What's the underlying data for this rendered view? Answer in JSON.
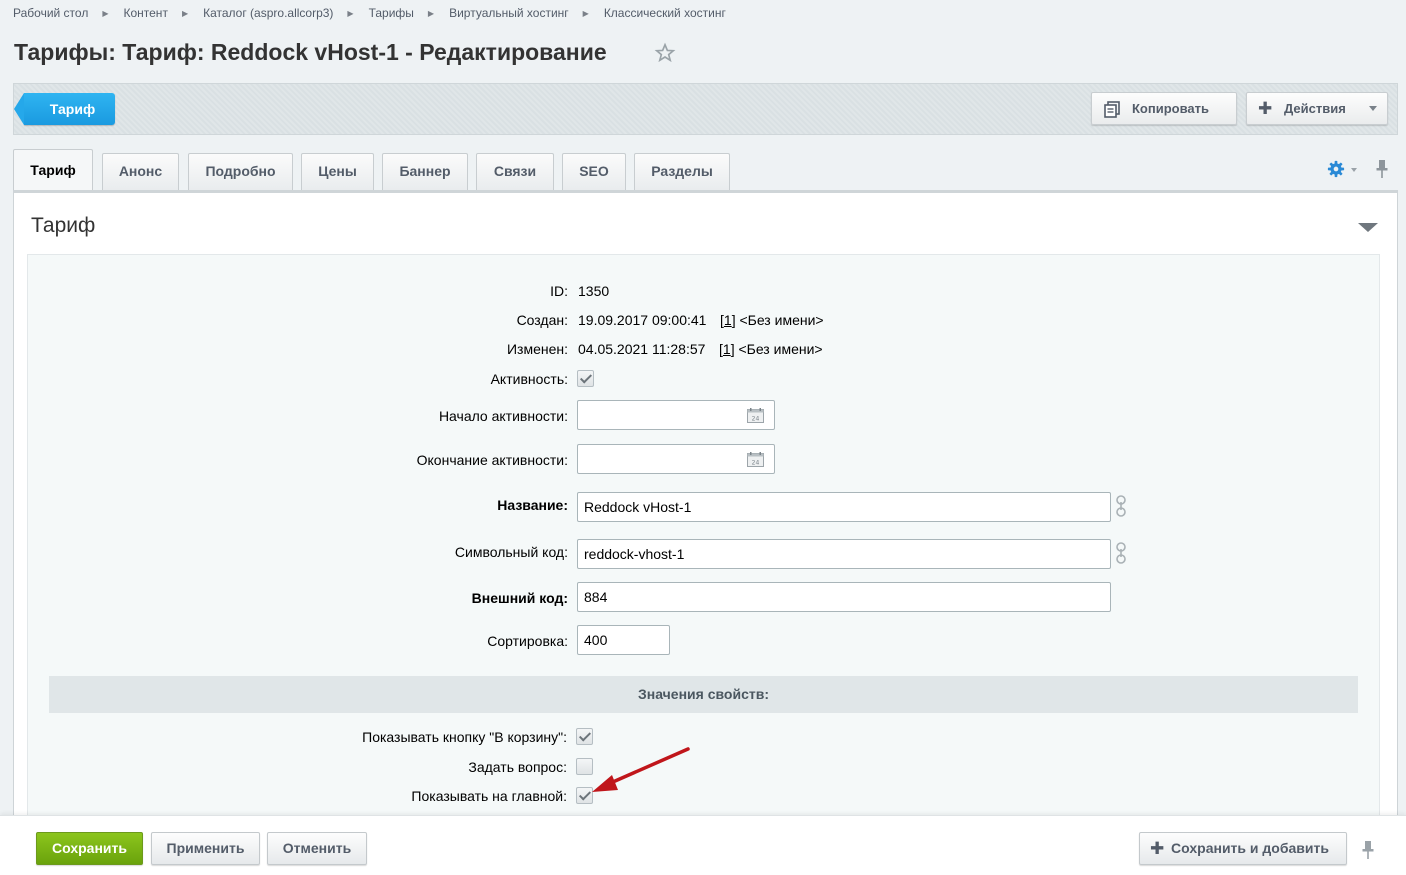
{
  "breadcrumb": [
    "Рабочий стол",
    "Контент",
    "Каталог (aspro.allcorp3)",
    "Тарифы",
    "Виртуальный хостинг",
    "Классический хостинг"
  ],
  "page_title": "Тарифы: Тариф: Reddock vHost-1 - Редактирование",
  "toolbar": {
    "context_tab": "Тариф",
    "copy_label": "Копировать",
    "actions_label": "Действия"
  },
  "tabs": [
    "Тариф",
    "Анонс",
    "Подробно",
    "Цены",
    "Баннер",
    "Связи",
    "SEO",
    "Разделы"
  ],
  "section": {
    "title": "Тариф",
    "fields": {
      "id_label": "ID:",
      "id_value": "1350",
      "created_label": "Создан:",
      "created_value": "19.09.2017 09:00:41",
      "created_user_id": "1",
      "created_user_name": "<Без имени>",
      "modified_label": "Изменен:",
      "modified_value": "04.05.2021 11:28:57",
      "modified_user_id": "1",
      "modified_user_name": "<Без имени>",
      "active_label": "Активность:",
      "active_checked": true,
      "active_from_label": "Начало активности:",
      "active_from_value": "",
      "active_to_label": "Окончание активности:",
      "active_to_value": "",
      "name_label": "Название:",
      "name_value": "Reddock vHost-1",
      "code_label": "Символьный код:",
      "code_value": "reddock-vhost-1",
      "xml_id_label": "Внешний код:",
      "xml_id_value": "884",
      "sort_label": "Сортировка:",
      "sort_value": "400"
    },
    "properties_header": "Значения свойств:",
    "properties": [
      {
        "label": "Показывать кнопку \"В корзину\":",
        "checked": true
      },
      {
        "label": "Задать вопрос:",
        "checked": false
      },
      {
        "label": "Показывать на главной:",
        "checked": true
      }
    ]
  },
  "footer": {
    "save": "Сохранить",
    "apply": "Применить",
    "cancel": "Отменить",
    "save_and_add": "Сохранить и добавить"
  },
  "colors": {
    "accent_blue": "#1a9ae0",
    "save_green": "#7bb414",
    "annotation_red": "#c0161b"
  }
}
